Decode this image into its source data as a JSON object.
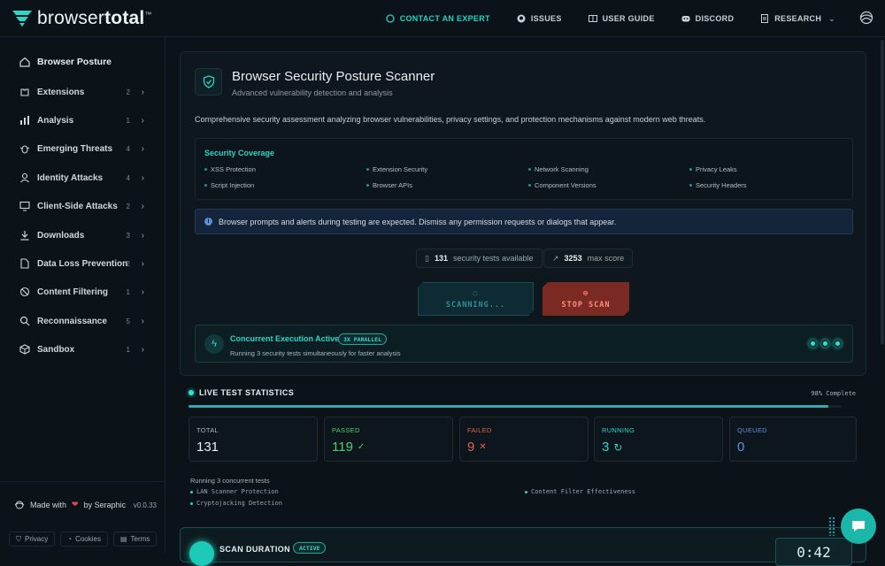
{
  "brand": {
    "name_light": "browser",
    "name_bold": "total",
    "tm": "™"
  },
  "nav": [
    {
      "label": "CONTACT AN EXPERT",
      "icon": "chat-icon",
      "accent": true
    },
    {
      "label": "ISSUES",
      "icon": "github-icon"
    },
    {
      "label": "USER GUIDE",
      "icon": "book-icon"
    },
    {
      "label": "DISCORD",
      "icon": "discord-icon"
    },
    {
      "label": "RESEARCH",
      "icon": "document-icon",
      "dropdown": true
    }
  ],
  "sidebar": {
    "top": {
      "label": "Browser Posture",
      "icon": "home-icon"
    },
    "items": [
      {
        "label": "Extensions",
        "count": "2",
        "icon": "puzzle-icon"
      },
      {
        "label": "Analysis",
        "count": "1",
        "icon": "chart-icon"
      },
      {
        "label": "Emerging Threats",
        "count": "4",
        "icon": "bug-icon"
      },
      {
        "label": "Identity Attacks",
        "count": "4",
        "icon": "user-icon"
      },
      {
        "label": "Client-Side Attacks",
        "count": "2",
        "icon": "monitor-icon"
      },
      {
        "label": "Downloads",
        "count": "3",
        "icon": "download-icon"
      },
      {
        "label": "Data Loss Prevention",
        "count": "2",
        "icon": "file-icon"
      },
      {
        "label": "Content Filtering",
        "count": "1",
        "icon": "block-icon"
      },
      {
        "label": "Reconnaissance",
        "count": "5",
        "icon": "search-icon"
      },
      {
        "label": "Sandbox",
        "count": "1",
        "icon": "box-icon"
      }
    ],
    "footer": {
      "made_prefix": "Made with",
      "made_suffix": "by Seraphic",
      "version": "v0.0.33",
      "links": [
        "Privacy",
        "Cookies",
        "Terms"
      ]
    }
  },
  "scanner": {
    "title": "Browser Security Posture Scanner",
    "subtitle": "Advanced vulnerability detection and analysis",
    "description": "Comprehensive security assessment analyzing browser vulnerabilities, privacy settings, and protection mechanisms against modern web threats.",
    "coverage_title": "Security Coverage",
    "coverage": [
      "XSS Protection",
      "Extension Security",
      "Network Scanning",
      "Privacy Leaks",
      "Script Injection",
      "Browser APIs",
      "Component Versions",
      "Security Headers"
    ],
    "notice": "Browser prompts and alerts during testing are expected. Dismiss any permission requests or dialogs that appear.",
    "tests_count": "131",
    "tests_label": "security tests available",
    "max_score": "3253",
    "max_score_label": "max score",
    "scanning_label": "SCANNING...",
    "stop_label": "STOP SCAN",
    "concurrent_title": "Concurrent Execution Active",
    "concurrent_badge": "3X PARALLEL",
    "concurrent_sub": "Running 3 security tests simultaneously for faster analysis"
  },
  "stats": {
    "title": "LIVE TEST STATISTICS",
    "complete": "98% Complete",
    "progress": 0.98,
    "cards": [
      {
        "label": "TOTAL",
        "value": "131",
        "kind": "total",
        "mark": ""
      },
      {
        "label": "PASSED",
        "value": "119",
        "kind": "passed",
        "mark": "✓"
      },
      {
        "label": "FAILED",
        "value": "9",
        "kind": "failed",
        "mark": "✕"
      },
      {
        "label": "RUNNING",
        "value": "3",
        "kind": "running",
        "mark": "↻"
      },
      {
        "label": "QUEUED",
        "value": "0",
        "kind": "queued",
        "mark": ""
      }
    ],
    "running_head": "Running 3 concurrent tests",
    "running": [
      "LAN Scanner Protection",
      "Content Filter Effectiveness",
      "Cryptojacking Detection"
    ]
  },
  "duration": {
    "title": "SCAN DURATION",
    "badge": "ACTIVE",
    "timer": "0:42"
  },
  "colors": {
    "accent": "#2bd5c7",
    "passed": "#4fcf6c",
    "failed": "#e4624c",
    "queued": "#5f93d8",
    "stop": "#7a2a23"
  }
}
